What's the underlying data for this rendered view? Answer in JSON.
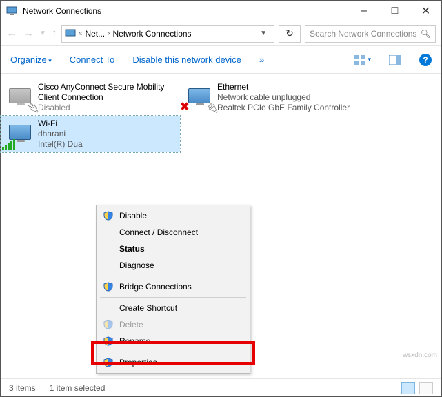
{
  "window": {
    "title": "Network Connections"
  },
  "breadcrumb": {
    "level1": "Net...",
    "level2": "Network Connections"
  },
  "search": {
    "placeholder": "Search Network Connections"
  },
  "toolbar": {
    "organize": "Organize",
    "connect_to": "Connect To",
    "disable": "Disable this network device",
    "more": "»"
  },
  "connections": {
    "cisco": {
      "name": "Cisco AnyConnect Secure Mobility Client Connection",
      "status": "Disabled"
    },
    "ethernet": {
      "name": "Ethernet",
      "status": "Network cable unplugged",
      "adapter": "Realtek PCIe GbE Family Controller"
    },
    "wifi": {
      "name": "Wi-Fi",
      "status": "dharani",
      "adapter": "Intel(R) Dua"
    }
  },
  "context_menu": {
    "disable": "Disable",
    "connect": "Connect / Disconnect",
    "status": "Status",
    "diagnose": "Diagnose",
    "bridge": "Bridge Connections",
    "shortcut": "Create Shortcut",
    "delete": "Delete",
    "rename": "Rename",
    "properties": "Properties"
  },
  "statusbar": {
    "count": "3 items",
    "selected": "1 item selected"
  },
  "watermark": "wsxdn.com"
}
